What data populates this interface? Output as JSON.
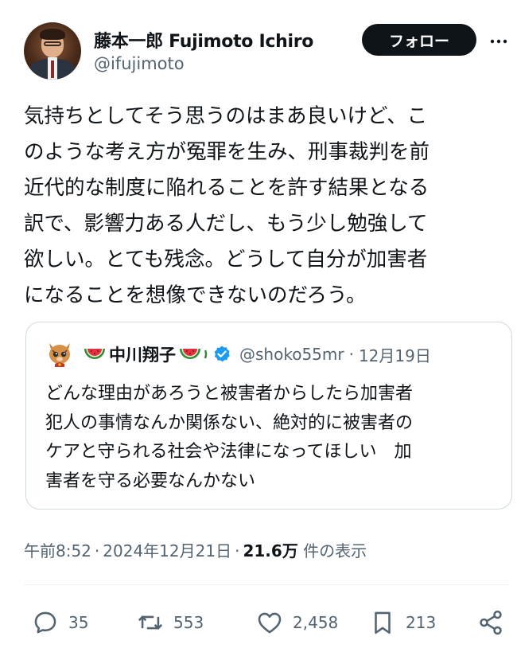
{
  "user": {
    "name": "藤本一郎 Fujimoto Ichiro",
    "handle": "@ifujimoto",
    "follow_label": "フォロー"
  },
  "tweet": {
    "lines": [
      "気持ちとしてそう思うのはまあ良いけど、こ",
      "のような考え方が冤罪を生み、刑事裁判を前",
      "近代的な制度に陥れることを許す結果となる",
      "訳で、影響力ある人だし、もう少し勉強して",
      "欲しい。とても残念。どうして自分が加害者",
      "になることを想像できないのだろう。"
    ]
  },
  "quote": {
    "name": "中川翔子",
    "name_prefix_emoji": "watermelon",
    "name_suffix_emoji": "watermelon",
    "verified": true,
    "handle": "@shoko55mr",
    "date": "12月19日",
    "lines": [
      "どんな理由があろうと被害者からしたら加害者",
      "犯人の事情なんか関係ない、絶対的に被害者の",
      "ケアと守られる社会や法律になってほしい　加",
      "害者を守る必要なんかない"
    ]
  },
  "meta": {
    "time": "午前8:52",
    "date": "2024年12月21日",
    "views_count": "21.6万",
    "views_label": "件の表示"
  },
  "actions": {
    "replies": "35",
    "retweets": "553",
    "likes": "2,458",
    "bookmarks": "213"
  },
  "icons": [
    "more-icon",
    "verified-badge-icon",
    "watermelon-icon",
    "cat-avatar-icon",
    "reply-icon",
    "retweet-icon",
    "like-icon",
    "bookmark-icon",
    "share-icon"
  ],
  "colors": {
    "text": "#0f1419",
    "secondary": "#536471",
    "verified": "#1d9bf0",
    "button_bg": "#0f1419",
    "border": "#cfd9de"
  }
}
